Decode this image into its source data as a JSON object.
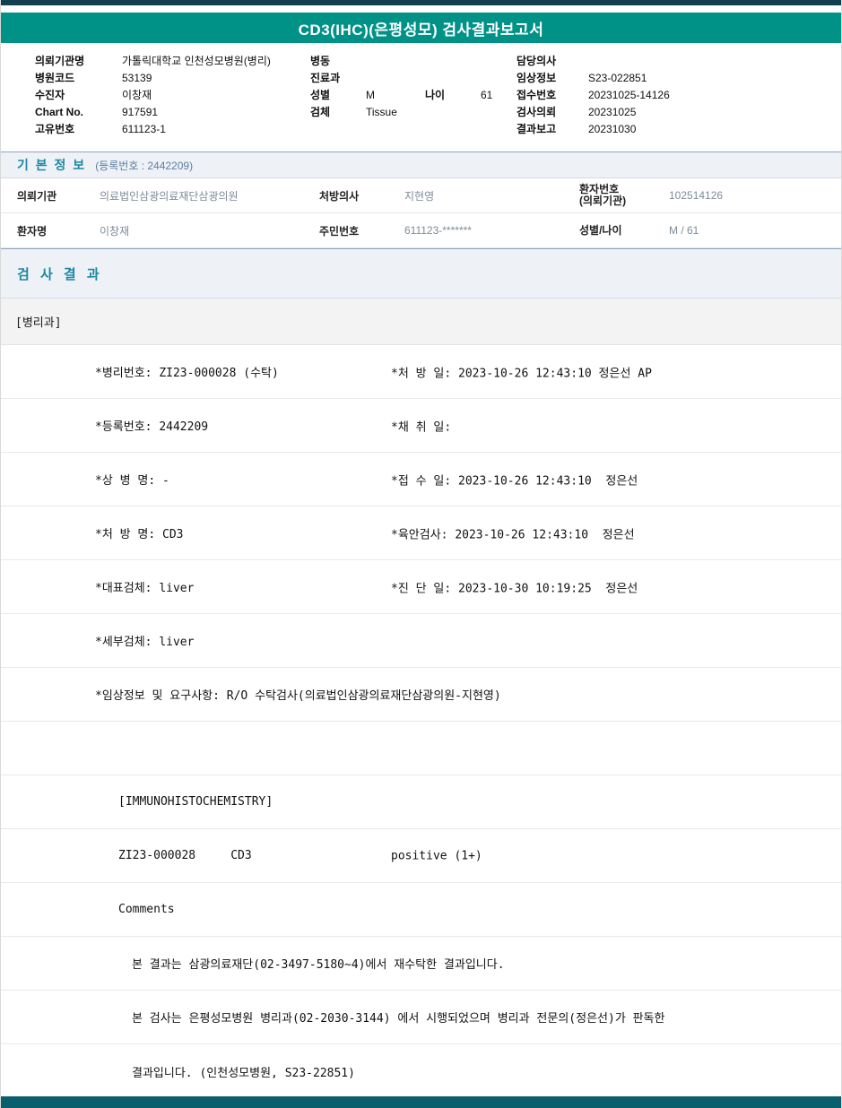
{
  "report": {
    "title": "CD3(IHC)(은평성모) 검사결과보고서"
  },
  "patient_header": {
    "left": [
      {
        "label": "의뢰기관명",
        "value": "가톨릭대학교 인천성모병원(병리)"
      },
      {
        "label": "병원코드",
        "value": "53139"
      },
      {
        "label": "수진자",
        "value": "이창재"
      },
      {
        "label": "Chart No.",
        "value": "917591"
      },
      {
        "label": "고유번호",
        "value": "611123-1"
      }
    ],
    "middle": [
      {
        "label": "병동",
        "value": ""
      },
      {
        "label": "진료과",
        "value": ""
      },
      {
        "label": "성별",
        "value": "M",
        "label2": "나이",
        "value2": "61"
      },
      {
        "label": "검체",
        "value": "Tissue"
      }
    ],
    "right": [
      {
        "label": "담당의사",
        "value": ""
      },
      {
        "label": "임상정보",
        "value": "S23-022851"
      },
      {
        "label": "접수번호",
        "value": "20231025-14126"
      },
      {
        "label": "검사의뢰",
        "value": "20231025"
      },
      {
        "label": "결과보고",
        "value": "20231030"
      }
    ]
  },
  "basic_info": {
    "title": "기 본 정 보",
    "registration": "(등록번호 : 2442209)",
    "row1": {
      "c1_label": "의뢰기관",
      "c1_value": "의료법인삼광의료재단삼광의원",
      "c2_label": "처방의사",
      "c2_value": "지현영",
      "c3_label": "환자번호",
      "c3_sublabel": "(의뢰기관)",
      "c3_value": "102514126"
    },
    "row2": {
      "c1_label": "환자명",
      "c1_value": "이창재",
      "c2_label": "주민번호",
      "c2_value": "611123-*******",
      "c3_label": "성별/나이",
      "c3_sublabel": "",
      "c3_value": "M / 61"
    }
  },
  "results": {
    "title": "검 사 결 과",
    "department": "[병리과]",
    "lines": [
      {
        "left": "*병리번호: ZI23-000028 (수탁)",
        "right": "*처 방 일: 2023-10-26 12:43:10 정은선 AP"
      },
      {
        "left": "*등록번호: 2442209",
        "right": "*채 취 일:"
      },
      {
        "left": "*상 병 명: -",
        "right": "*접 수 일: 2023-10-26 12:43:10  정은선"
      },
      {
        "left": "*처 방 명: CD3",
        "right": "*육안검사: 2023-10-26 12:43:10  정은선"
      },
      {
        "left": "*대표검체: liver",
        "right": "*진 단 일: 2023-10-30 10:19:25  정은선"
      },
      {
        "left": "*세부검체: liver",
        "right": ""
      },
      {
        "left": "*임상정보 및 요구사항: R/O 수탁검사(의료법인삼광의료재단삼광의원-지현영)",
        "right": ""
      },
      {
        "left": "",
        "right": ""
      },
      {
        "left": "[IMMUNOHISTOCHEMISTRY]",
        "right": ""
      },
      {
        "left": "ZI23-000028     CD3",
        "right": "positive (1+)"
      },
      {
        "left": "Comments",
        "right": ""
      },
      {
        "left": "본 결과는 삼광의료재단(02-3497-5180~4)에서 재수탁한 결과입니다.",
        "right": ""
      },
      {
        "left": "본 검사는 은평성모병원 병리과(02-2030-3144) 에서 시행되었으며 병리과 전문의(정은선)가 판독한",
        "right": ""
      },
      {
        "left": "결과입니다. (인천성모병원, S23-22851)",
        "right": ""
      }
    ]
  }
}
